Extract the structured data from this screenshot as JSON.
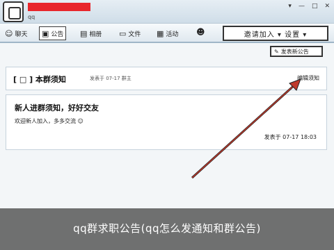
{
  "window": {
    "group_name": "",
    "subtitle": "qq",
    "controls": [
      "▾",
      "—",
      "□",
      "✕"
    ]
  },
  "tabs": [
    {
      "icon": "☺",
      "label": "聊天",
      "active": false
    },
    {
      "icon": "▣",
      "label": "公告",
      "active": true
    },
    {
      "icon": "▤",
      "label": "相册",
      "active": false
    },
    {
      "icon": "▭",
      "label": "文件",
      "active": false
    },
    {
      "icon": "▦",
      "label": "活动",
      "active": false
    }
  ],
  "toolbar": {
    "more_icon": "☻",
    "invite_label": "邀请加入 ▾ 设置 ▾"
  },
  "publish": {
    "icon": "✎",
    "label": "发表新公告"
  },
  "notice": {
    "title": "[ □ ] 本群须知",
    "meta": "发表于 07-17 群主",
    "link": "编辑须知"
  },
  "message": {
    "title": "新人进群须知，好好交友",
    "body": "欢迎新人加入，多多交流 ☺",
    "time": "发表于 07-17 18:03"
  },
  "caption": "qq群求职公告(qq怎么发通知和群公告)"
}
